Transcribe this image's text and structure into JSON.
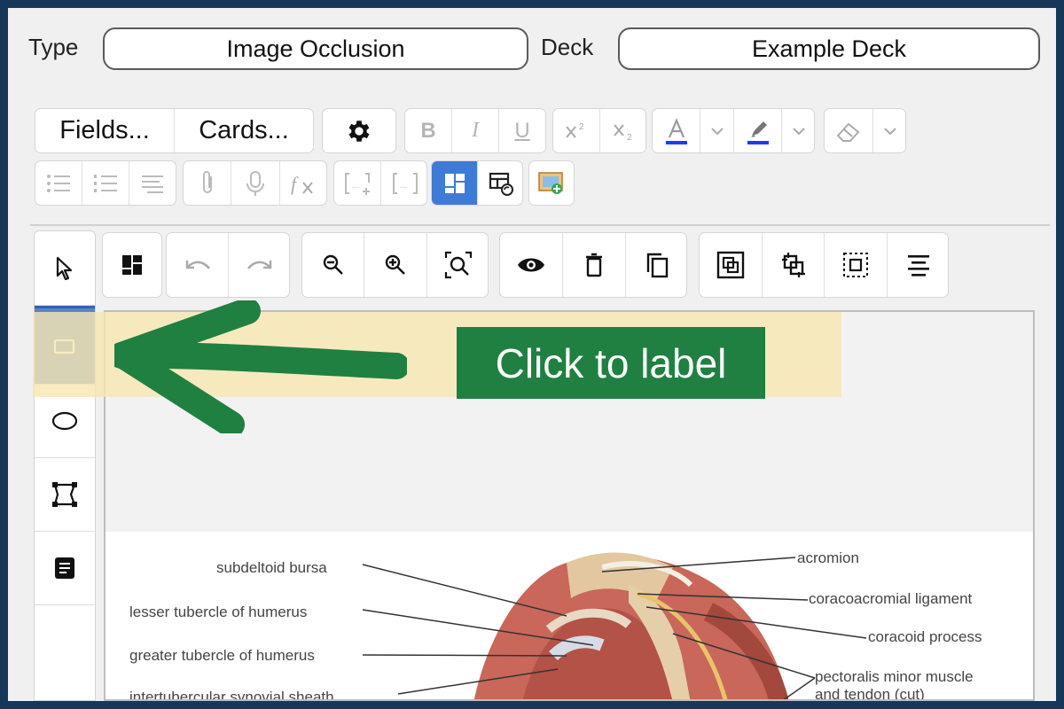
{
  "header": {
    "type_label": "Type",
    "type_value": "Image Occlusion",
    "deck_label": "Deck",
    "deck_value": "Example Deck"
  },
  "toolbar": {
    "fields_label": "Fields...",
    "cards_label": "Cards...",
    "bold_label": "B",
    "italic_label": "I",
    "underline_label": "U",
    "text_color": "#1a3cff",
    "highlight_color": "#1a3cff"
  },
  "occlusion_tools": {
    "active_tool": "rectangle",
    "tools": [
      "select",
      "rectangle",
      "ellipse",
      "polygon",
      "text"
    ]
  },
  "callout": {
    "text": "Click to label",
    "color": "#1f8041"
  },
  "image": {
    "labels_left": [
      "subdeltoid bursa",
      "lesser tubercle of humerus",
      "greater tubercle of humerus",
      "intertubercular synovial sheath"
    ],
    "labels_right": [
      "acromion",
      "coracoacromial ligament",
      "coracoid process",
      "pectoralis minor muscle",
      "and tendon (cut)"
    ]
  }
}
